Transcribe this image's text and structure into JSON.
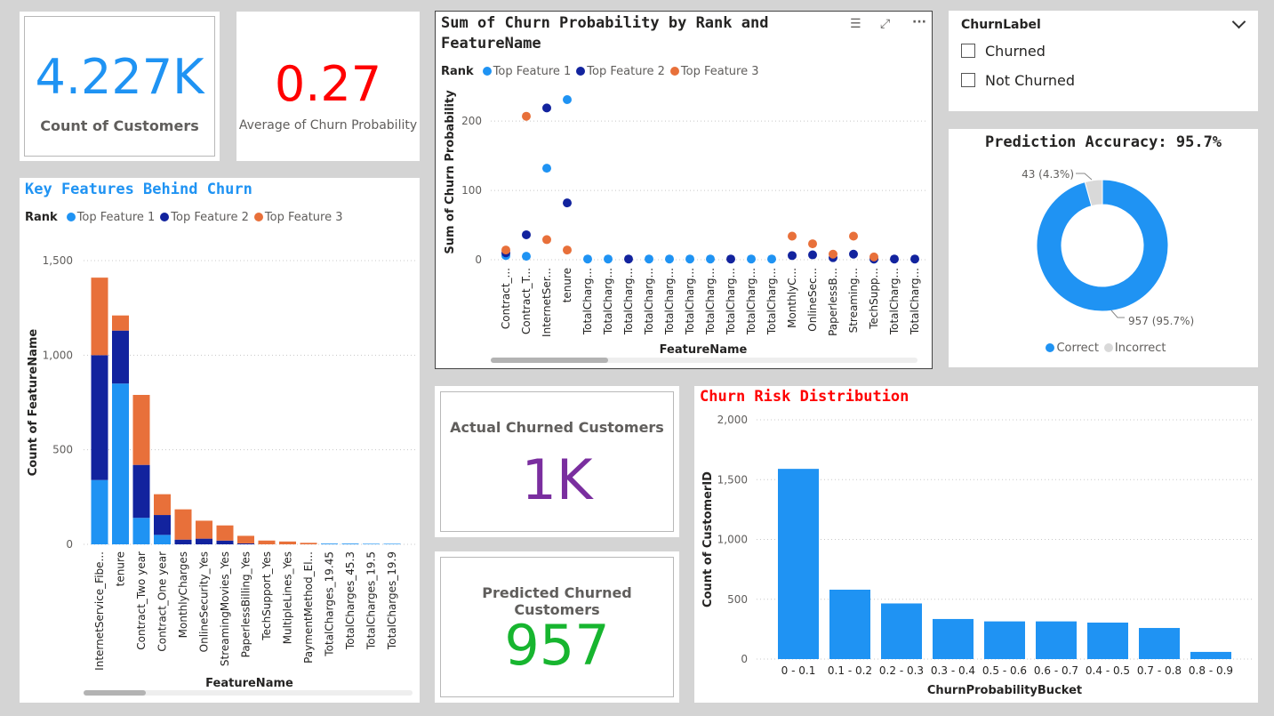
{
  "colors": {
    "top1": "#1f93f3",
    "top2": "#12239e",
    "top3": "#e8703a",
    "blue": "#1f93f3",
    "kpi_blue": "#1f93f3",
    "kpi_red": "#ff0000",
    "kpi_purple": "#7a2e9f",
    "kpi_green": "#17b52f",
    "incorrect": "#d9d9d9",
    "title_blue": "#1f93f3",
    "title_red": "#ff0000"
  },
  "kpis": {
    "count_customers": {
      "value": "4.227K",
      "label": "Count of Customers"
    },
    "avg_churn": {
      "value": "0.27",
      "label": "Average of Churn Probability"
    },
    "actual_churned": {
      "value": "1K",
      "label": "Actual Churned Customers"
    },
    "predicted_churned": {
      "value": "957",
      "label": "Predicted Churned Customers"
    }
  },
  "slicer": {
    "title": "ChurnLabel",
    "options": [
      "Churned",
      "Not Churned"
    ]
  },
  "key_features": {
    "title": "Key Features Behind Churn",
    "legend_title": "Rank",
    "legend": [
      "Top Feature 1",
      "Top Feature 2",
      "Top Feature 3"
    ]
  },
  "scatter": {
    "title_line1": "Sum of Churn Probability by Rank and",
    "title_line2": "FeatureName",
    "legend_title": "Rank",
    "legend": [
      "Top Feature 1",
      "Top Feature 2",
      "Top Feature 3"
    ]
  },
  "accuracy": {
    "title": "Prediction Accuracy: 95.7%",
    "legend": [
      "Correct",
      "Incorrect"
    ],
    "label_correct": "957 (95.7%)",
    "label_incorrect": "43 (4.3%)"
  },
  "risk": {
    "title": "Churn Risk Distribution"
  },
  "chart_data": [
    {
      "id": "key_features",
      "type": "bar",
      "stacked": true,
      "title": "Key Features Behind Churn",
      "xlabel": "FeatureName",
      "ylabel": "Count of FeatureName",
      "ylim": [
        0,
        1500
      ],
      "yticks": [
        0,
        500,
        1000,
        1500
      ],
      "ytick_labels": [
        "0",
        "500",
        "1,000",
        "1,500"
      ],
      "grid": true,
      "legend_position": "top-left",
      "categories": [
        "InternetService_Fibe...",
        "tenure",
        "Contract_Two year",
        "Contract_One year",
        "MonthlyCharges",
        "OnlineSecurity_Yes",
        "StreamingMovies_Yes",
        "PaperlessBilling_Yes",
        "TechSupport_Yes",
        "MultipleLines_Yes",
        "PaymentMethod_El...",
        "TotalCharges_19.45",
        "TotalCharges_45.3",
        "TotalCharges_19.5",
        "TotalCharges_19.9"
      ],
      "series": [
        {
          "name": "Top Feature 1",
          "values": [
            340,
            850,
            140,
            50,
            0,
            0,
            0,
            0,
            0,
            0,
            0,
            4,
            4,
            3,
            3
          ]
        },
        {
          "name": "Top Feature 2",
          "values": [
            660,
            280,
            280,
            105,
            25,
            30,
            20,
            5,
            0,
            0,
            0,
            0,
            0,
            0,
            0
          ]
        },
        {
          "name": "Top Feature 3",
          "values": [
            410,
            80,
            370,
            110,
            160,
            95,
            80,
            40,
            20,
            15,
            8,
            0,
            0,
            0,
            0
          ]
        }
      ]
    },
    {
      "id": "scatter",
      "type": "scatter",
      "title": "Sum of Churn Probability by Rank and FeatureName",
      "xlabel": "FeatureName",
      "ylabel": "Sum of Churn Probability",
      "ylim": [
        0,
        240
      ],
      "yticks": [
        0,
        100,
        200
      ],
      "grid": true,
      "legend_position": "top-left",
      "categories": [
        "Contract_...",
        "Contract_T...",
        "InternetSer...",
        "tenure",
        "TotalCharg...",
        "TotalCharg...",
        "TotalCharg...",
        "TotalCharg...",
        "TotalCharg...",
        "TotalCharg...",
        "TotalCharg...",
        "TotalCharg...",
        "TotalCharg...",
        "TotalCharg...",
        "MonthlyC...",
        "OnlineSec...",
        "PaperlessB...",
        "Streaming...",
        "TechSupp...",
        "TotalCharg...",
        "TotalCharg..."
      ],
      "series": [
        {
          "name": "Top Feature 1",
          "values": [
            6,
            5,
            132,
            231,
            1,
            1,
            null,
            1,
            1,
            1,
            1,
            null,
            1,
            1,
            null,
            null,
            null,
            null,
            1,
            null,
            null
          ]
        },
        {
          "name": "Top Feature 2",
          "values": [
            10,
            36,
            219,
            82,
            null,
            null,
            1,
            null,
            null,
            null,
            null,
            1,
            null,
            null,
            6,
            7,
            3,
            8,
            1,
            1,
            1
          ]
        },
        {
          "name": "Top Feature 3",
          "values": [
            14,
            207,
            29,
            14,
            null,
            null,
            null,
            null,
            null,
            null,
            null,
            null,
            null,
            null,
            34,
            23,
            8,
            34,
            4,
            null,
            null
          ]
        }
      ]
    },
    {
      "id": "accuracy",
      "type": "pie",
      "donut": true,
      "title": "Prediction Accuracy: 95.7%",
      "legend_position": "bottom",
      "categories": [
        "Correct",
        "Incorrect"
      ],
      "values": [
        957,
        43
      ],
      "data_labels": [
        "957 (95.7%)",
        "43 (4.3%)"
      ]
    },
    {
      "id": "risk",
      "type": "bar",
      "title": "Churn Risk Distribution",
      "xlabel": "ChurnProbabilityBucket",
      "ylabel": "Count of CustomerID",
      "ylim": [
        0,
        2000
      ],
      "yticks": [
        0,
        500,
        1000,
        1500,
        2000
      ],
      "ytick_labels": [
        "0",
        "500",
        "1,000",
        "1,500",
        "2,000"
      ],
      "grid": true,
      "categories": [
        "0 - 0.1",
        "0.1 - 0.2",
        "0.2 - 0.3",
        "0.3 - 0.4",
        "0.5 - 0.6",
        "0.6 - 0.7",
        "0.4 - 0.5",
        "0.7 - 0.8",
        "0.8 - 0.9"
      ],
      "values": [
        1590,
        580,
        465,
        335,
        315,
        315,
        305,
        260,
        60
      ]
    }
  ]
}
